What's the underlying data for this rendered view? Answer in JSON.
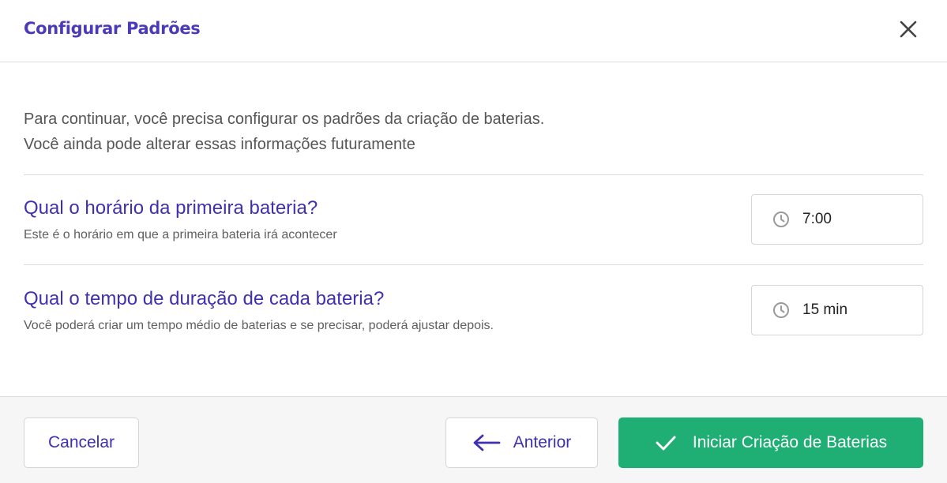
{
  "dialog": {
    "title": "Configurar Padrões"
  },
  "intro": {
    "line1": "Para continuar, você precisa configurar os padrões da criação de baterias.",
    "line2": "Você ainda pode alterar essas informações futuramente"
  },
  "questions": [
    {
      "title": "Qual o horário da primeira bateria?",
      "description": "Este é o horário em que a primeira bateria irá acontecer",
      "value": "7:00",
      "icon": "clock-icon"
    },
    {
      "title": "Qual o tempo de duração de cada bateria?",
      "description": "Você poderá criar um tempo médio de baterias e se precisar, poderá ajustar depois.",
      "value": "15 min",
      "icon": "clock-icon"
    }
  ],
  "footer": {
    "cancel_label": "Cancelar",
    "previous_label": "Anterior",
    "start_label": "Iniciar Criação de Baterias"
  },
  "colors": {
    "accent": "#4b3bb8",
    "primary_button": "#1fae74"
  }
}
